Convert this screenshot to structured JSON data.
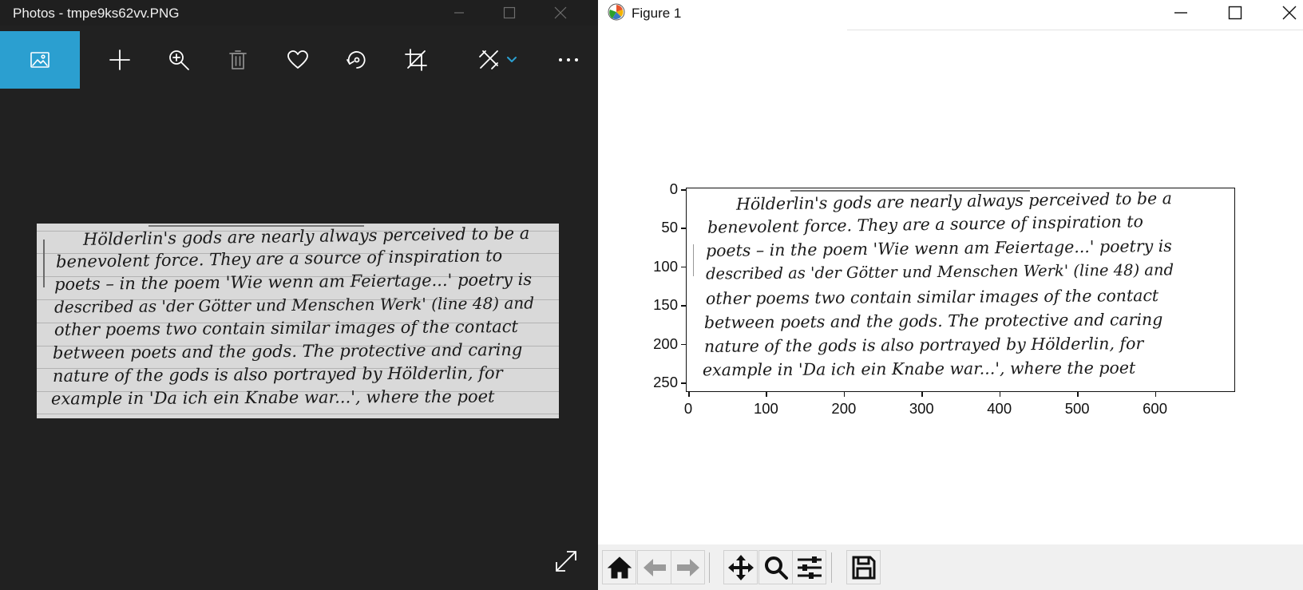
{
  "photos_window": {
    "title": "Photos - tmpe9ks62vv.PNG",
    "toolbar": {
      "icons": [
        "photo-icon",
        "add-icon",
        "zoom-icon",
        "delete-icon",
        "favorite-icon",
        "rotate-icon",
        "crop-icon",
        "edit-draw-icon",
        "chevron-down-icon",
        "more-icon"
      ],
      "accent": "#2b9fd0"
    },
    "image_text": [
      "Hölderlin's gods are nearly always perceived to be a",
      "benevolent force. They are a source of inspiration to",
      "poets – in the poem 'Wie wenn am Feiertage...' poetry is",
      "described as 'der Götter und Menschen Werk' (line 48) and",
      "other poems two contain similar images of the contact",
      "between poets and the gods. The protective and caring",
      "nature of the gods is also portrayed by Hölderlin, for",
      "example in 'Da ich ein Knabe war...', where the poet"
    ]
  },
  "figure_window": {
    "title": "Figure 1",
    "plot": {
      "type": "image",
      "y_ticks": [
        "0",
        "50",
        "100",
        "150",
        "200",
        "250"
      ],
      "x_ticks": [
        "0",
        "100",
        "200",
        "300",
        "400",
        "500",
        "600"
      ],
      "ylim": [
        0,
        260
      ],
      "xlim": [
        0,
        700
      ]
    },
    "toolbar": {
      "icons": [
        "home-icon",
        "back-icon",
        "forward-icon",
        "pan-icon",
        "zoom-icon",
        "configure-subplots-icon",
        "save-icon"
      ]
    }
  }
}
